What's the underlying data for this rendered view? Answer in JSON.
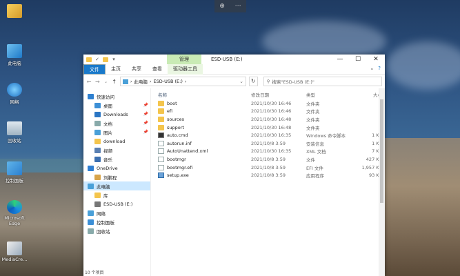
{
  "desktop": {
    "icons": [
      {
        "label": "",
        "icon": "user-folder-icon"
      },
      {
        "label": "此电脑",
        "icon": "computer-icon"
      },
      {
        "label": "网络",
        "icon": "network-icon"
      },
      {
        "label": "回收站",
        "icon": "recycle-bin-icon"
      },
      {
        "label": "控制面板",
        "icon": "control-panel-icon"
      },
      {
        "label": "Microsoft Edge",
        "icon": "edge-icon"
      },
      {
        "label": "MediaCre...",
        "icon": "media-creation-icon"
      }
    ]
  },
  "zoombar": {
    "zoom": "⊕",
    "more": "⋯"
  },
  "window": {
    "title": "ESD-USB (E:)",
    "manage_tab": "管理",
    "controls": {
      "minimize": "—",
      "maximize": "☐",
      "close": "✕"
    },
    "ribbon": {
      "tabs": [
        "文件",
        "主页",
        "共享",
        "查看",
        "驱动器工具"
      ],
      "expand": "⌄",
      "help": "?"
    },
    "address": {
      "back": "←",
      "forward": "→",
      "up": "↑",
      "path": [
        "此电脑",
        "ESD-USB (E:)"
      ],
      "separator": "›",
      "refresh": "↻",
      "search_placeholder": "搜索\"ESD-USB (E:)\""
    },
    "nav_pane": [
      {
        "label": "快速访问",
        "icon": "star-icon",
        "color": "#2f80d0",
        "pinned": false
      },
      {
        "label": "桌面",
        "icon": "desktop-icon",
        "color": "#3c8fd6",
        "pinned": true
      },
      {
        "label": "Downloads",
        "icon": "download-icon",
        "color": "#2b76c4",
        "pinned": true
      },
      {
        "label": "文档",
        "icon": "document-icon",
        "color": "#8aa",
        "pinned": true
      },
      {
        "label": "图片",
        "icon": "picture-icon",
        "color": "#4aa0d8",
        "pinned": true
      },
      {
        "label": "download",
        "icon": "folder-icon",
        "color": "#f4c54d",
        "pinned": false
      },
      {
        "label": "视频",
        "icon": "video-icon",
        "color": "#5a7fb2",
        "pinned": false
      },
      {
        "label": "音乐",
        "icon": "music-icon",
        "color": "#3c6fb0",
        "pinned": false
      },
      {
        "label": "OneDrive",
        "icon": "onedrive-icon",
        "color": "#2f7fd3",
        "pinned": false
      },
      {
        "label": "刘鹏程",
        "icon": "user-icon",
        "color": "#d8a44a",
        "pinned": false
      },
      {
        "label": "此电脑",
        "icon": "computer-icon",
        "color": "#4aa0d8",
        "pinned": false,
        "selected": true
      },
      {
        "label": "库",
        "icon": "library-icon",
        "color": "#f4c54d",
        "pinned": false
      },
      {
        "label": "ESD-USB (E:)",
        "icon": "usb-drive-icon",
        "color": "#777",
        "pinned": false
      },
      {
        "label": "网络",
        "icon": "network-icon",
        "color": "#4aa0d8",
        "pinned": false
      },
      {
        "label": "控制面板",
        "icon": "control-panel-icon",
        "color": "#3c8fd6",
        "pinned": false
      },
      {
        "label": "回收站",
        "icon": "recycle-bin-icon",
        "color": "#8aa",
        "pinned": false
      }
    ],
    "columns": {
      "name": "名称",
      "date": "修改日期",
      "type": "类型",
      "size": "大小"
    },
    "files": [
      {
        "name": "boot",
        "date": "2021/10/30 16:46",
        "type": "文件夹",
        "size": "",
        "kind": "folder"
      },
      {
        "name": "efi",
        "date": "2021/10/30 16:46",
        "type": "文件夹",
        "size": "",
        "kind": "folder"
      },
      {
        "name": "sources",
        "date": "2021/10/30 16:48",
        "type": "文件夹",
        "size": "",
        "kind": "folder"
      },
      {
        "name": "support",
        "date": "2021/10/30 16:48",
        "type": "文件夹",
        "size": "",
        "kind": "folder"
      },
      {
        "name": "auto.cmd",
        "date": "2021/10/30 16:35",
        "type": "Windows 命令脚本",
        "size": "1 KB",
        "kind": "cmd"
      },
      {
        "name": "autorun.inf",
        "date": "2021/10/8 3:59",
        "type": "安装信息",
        "size": "1 KB",
        "kind": "file"
      },
      {
        "name": "AutoUnattend.xml",
        "date": "2021/10/30 16:35",
        "type": "XML 文档",
        "size": "7 KB",
        "kind": "file"
      },
      {
        "name": "bootmgr",
        "date": "2021/10/8 3:59",
        "type": "文件",
        "size": "427 KB",
        "kind": "file"
      },
      {
        "name": "bootmgr.efi",
        "date": "2021/10/8 3:59",
        "type": "EFI 文件",
        "size": "1,957 KB",
        "kind": "file"
      },
      {
        "name": "setup.exe",
        "date": "2021/10/8 3:59",
        "type": "应用程序",
        "size": "93 KB",
        "kind": "exe"
      }
    ],
    "status": "10 个项目"
  }
}
